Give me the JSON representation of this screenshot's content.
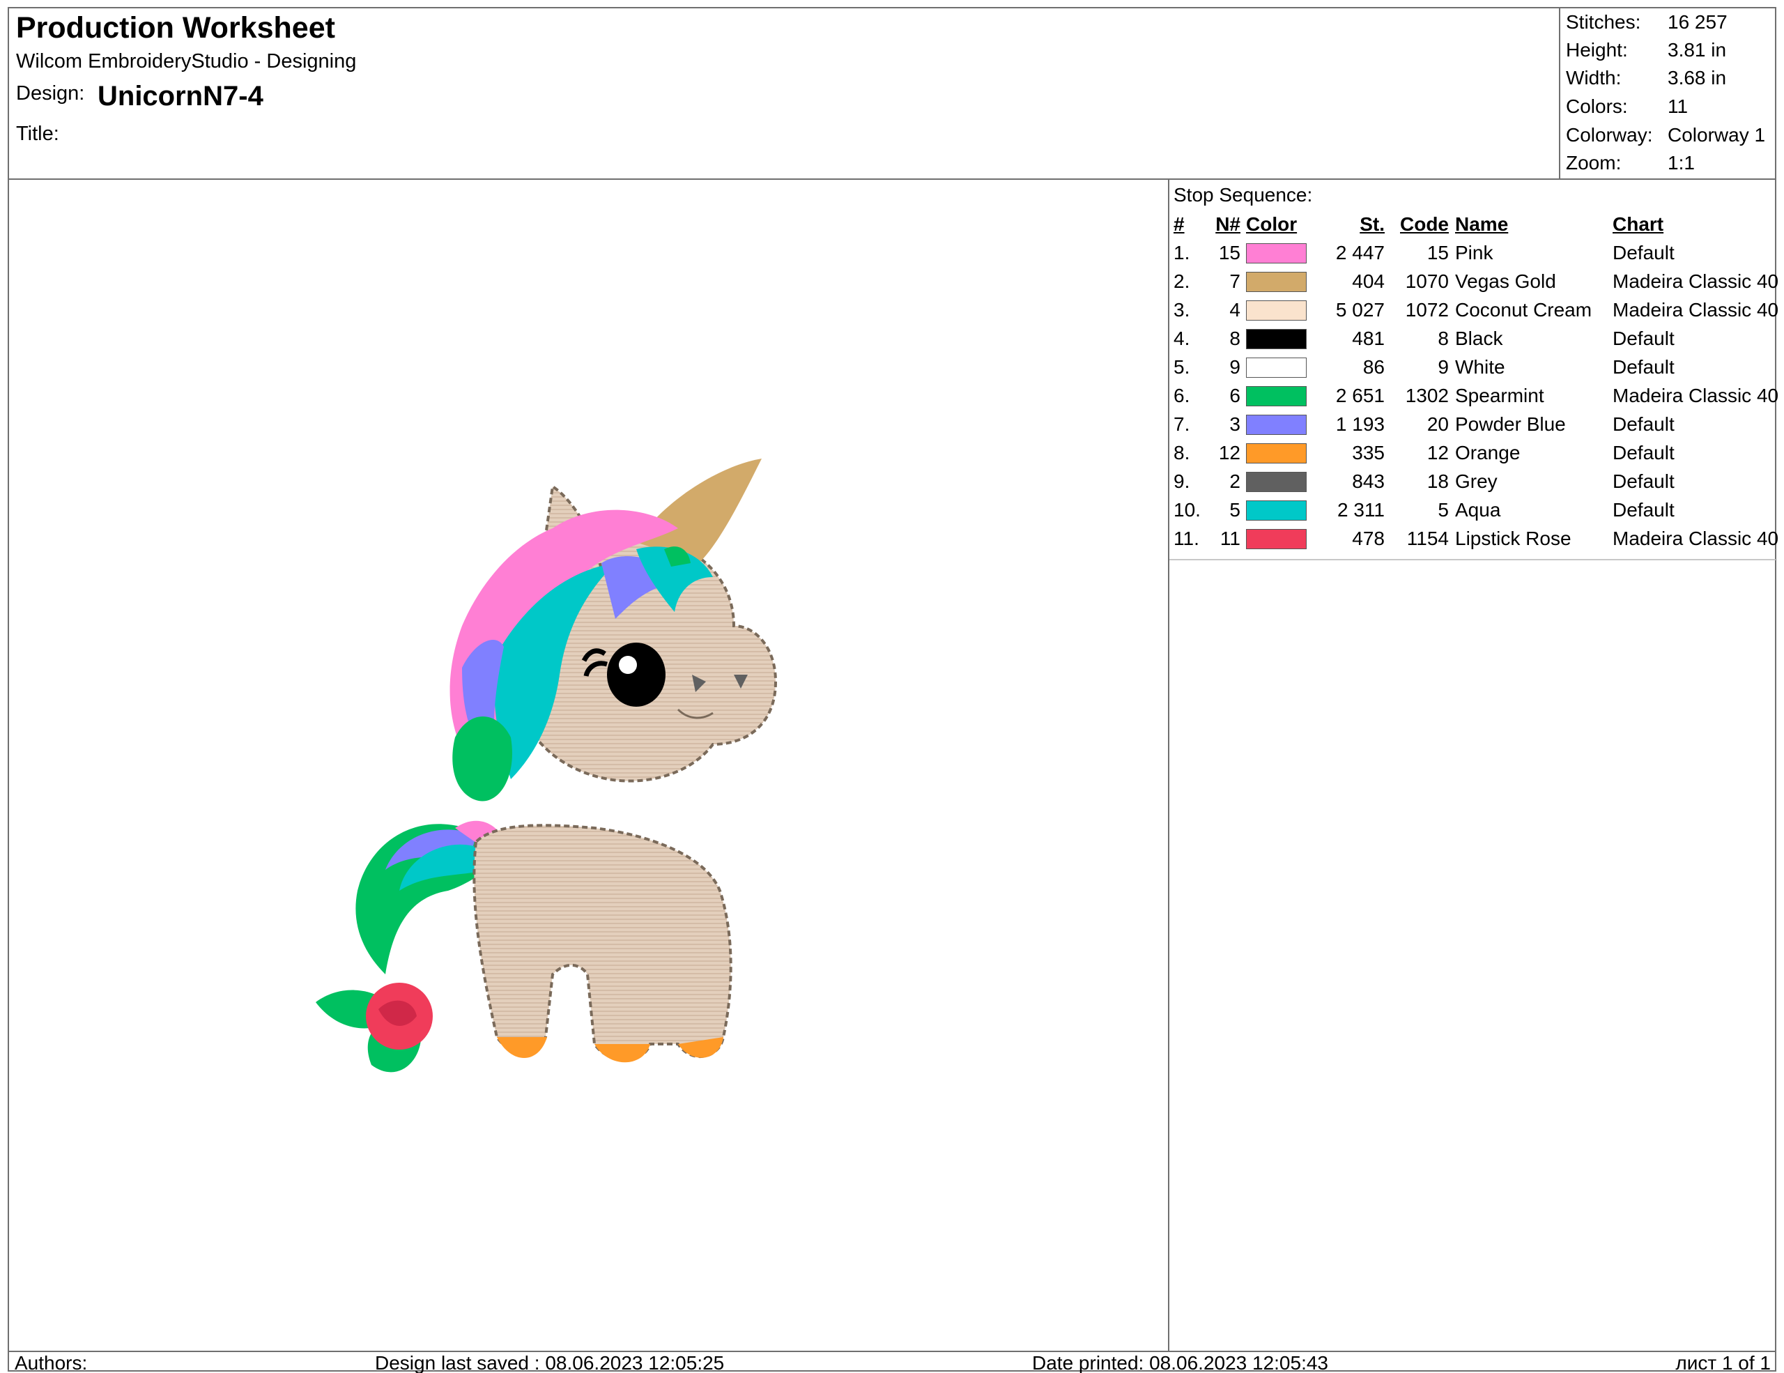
{
  "header": {
    "title": "Production Worksheet",
    "app": "Wilcom EmbroideryStudio - Designing",
    "design_label": "Design:",
    "design_name": "UnicornN7-4",
    "title_label": "Title:"
  },
  "stats": [
    {
      "label": "Stitches:",
      "value": "16 257"
    },
    {
      "label": "Height:",
      "value": "3.81 in"
    },
    {
      "label": "Width:",
      "value": "3.68 in"
    },
    {
      "label": "Colors:",
      "value": "11"
    },
    {
      "label": "Colorway:",
      "value": "Colorway 1"
    },
    {
      "label": "Zoom:",
      "value": "1:1"
    }
  ],
  "stop_sequence": {
    "label": "Stop Sequence:",
    "headers": {
      "idx": "#",
      "n": "N#",
      "color": "Color",
      "st": "St.",
      "code": "Code",
      "name": "Name",
      "chart": "Chart"
    },
    "rows": [
      {
        "idx": "1.",
        "n": "15",
        "swatch": "#ff7fd4",
        "st": "2 447",
        "code": "15",
        "name": "Pink",
        "chart": "Default"
      },
      {
        "idx": "2.",
        "n": "7",
        "swatch": "#d2aa6a",
        "st": "404",
        "code": "1070",
        "name": "Vegas Gold",
        "chart": "Madeira Classic 40"
      },
      {
        "idx": "3.",
        "n": "4",
        "swatch": "#fae3cd",
        "st": "5 027",
        "code": "1072",
        "name": "Coconut Cream",
        "chart": "Madeira Classic 40"
      },
      {
        "idx": "4.",
        "n": "8",
        "swatch": "#000000",
        "st": "481",
        "code": "8",
        "name": "Black",
        "chart": "Default"
      },
      {
        "idx": "5.",
        "n": "9",
        "swatch": "#ffffff",
        "st": "86",
        "code": "9",
        "name": "White",
        "chart": "Default"
      },
      {
        "idx": "6.",
        "n": "6",
        "swatch": "#00c060",
        "st": "2 651",
        "code": "1302",
        "name": "Spearmint",
        "chart": "Madeira Classic 40"
      },
      {
        "idx": "7.",
        "n": "3",
        "swatch": "#8080ff",
        "st": "1 193",
        "code": "20",
        "name": "Powder Blue",
        "chart": "Default"
      },
      {
        "idx": "8.",
        "n": "12",
        "swatch": "#ff9a28",
        "st": "335",
        "code": "12",
        "name": "Orange",
        "chart": "Default"
      },
      {
        "idx": "9.",
        "n": "2",
        "swatch": "#606060",
        "st": "843",
        "code": "18",
        "name": "Grey",
        "chart": "Default"
      },
      {
        "idx": "10.",
        "n": "5",
        "swatch": "#00c8c8",
        "st": "2 311",
        "code": "5",
        "name": "Aqua",
        "chart": "Default"
      },
      {
        "idx": "11.",
        "n": "11",
        "swatch": "#f03c5a",
        "st": "478",
        "code": "1154",
        "name": "Lipstick Rose",
        "chart": "Madeira Classic 40"
      }
    ]
  },
  "footer": {
    "authors": "Authors:",
    "saved": "Design last saved : 08.06.2023 12:05:25",
    "printed": "Date printed: 08.06.2023 12:05:43",
    "page": "лист 1 of 1"
  }
}
